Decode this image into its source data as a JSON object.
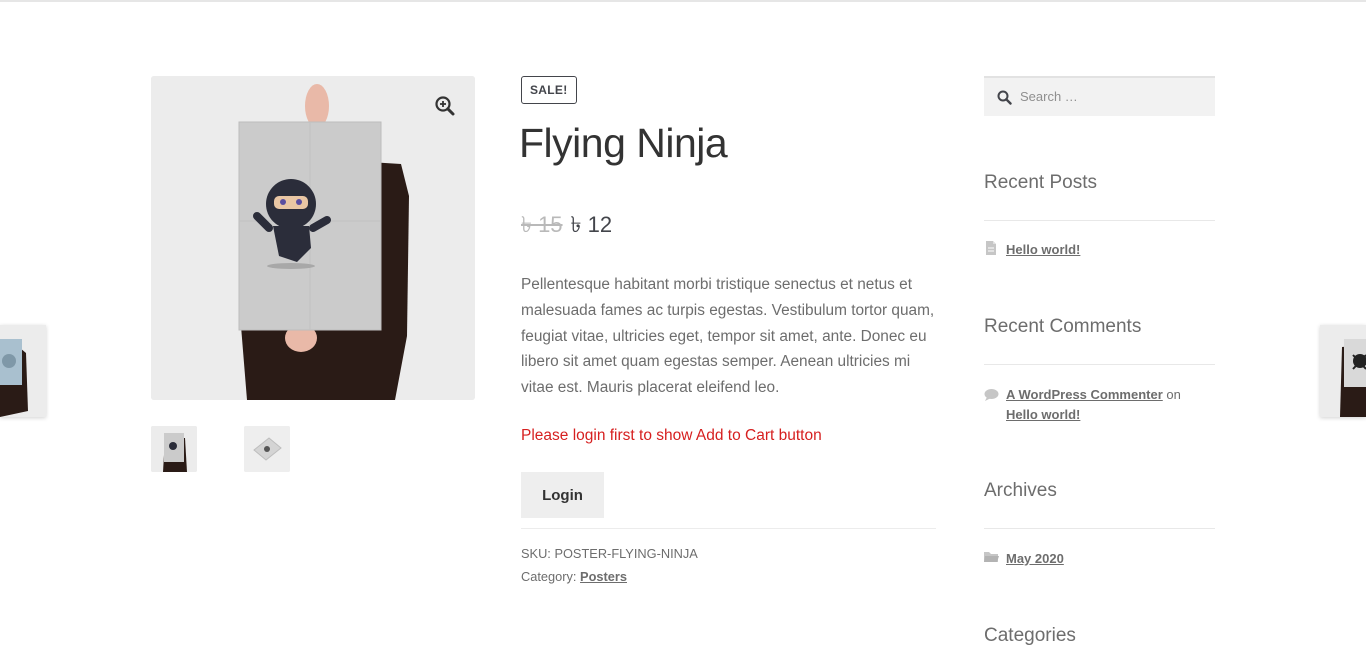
{
  "product": {
    "sale_badge": "SALE!",
    "title": "Flying Ninja",
    "price_old": "৳ 15",
    "price_new": "৳ 12",
    "description": "Pellentesque habitant morbi tristique senectus et netus et malesuada fames ac turpis egestas. Vestibulum tortor quam, feugiat vitae, ultricies eget, tempor sit amet, ante. Donec eu libero sit amet quam egestas semper. Aenean ultricies mi vitae est. Mauris placerat eleifend leo.",
    "login_note": "Please login first to show Add to Cart button",
    "login_button": "Login",
    "sku_label": "SKU:",
    "sku_value": "POSTER-FLYING-NINJA",
    "category_label": "Category:",
    "category_value": "Posters"
  },
  "sidebar": {
    "search_placeholder": "Search …",
    "recent_posts": {
      "title": "Recent Posts",
      "items": [
        "Hello world!"
      ]
    },
    "recent_comments": {
      "title": "Recent Comments",
      "author": "A WordPress Commenter",
      "on": "on",
      "post": "Hello world!"
    },
    "archives": {
      "title": "Archives",
      "items": [
        "May 2020"
      ]
    },
    "categories": {
      "title": "Categories"
    }
  },
  "colors": {
    "notice_red": "#d61f1f",
    "heading": "#333333",
    "body_text": "#6d6d6d",
    "button_bg": "#eeeeee"
  },
  "icons": [
    "zoom-in-icon",
    "search-icon",
    "document-icon",
    "comment-icon",
    "folder-icon"
  ]
}
